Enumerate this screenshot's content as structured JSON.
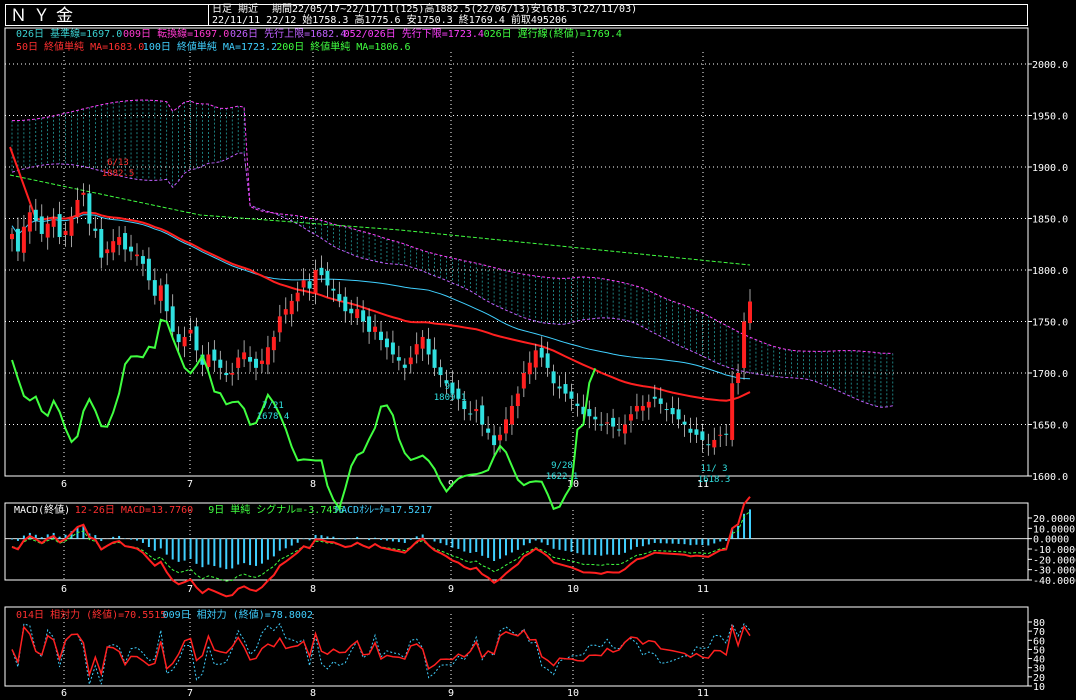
{
  "header": {
    "symbol": "ＮＹ金",
    "mode": "日足  期近",
    "period_info": "期間22/05/17~22/11/11(125)高1882.5(22/06/13)安1618.3(22/11/03)",
    "ohlc_info": "22/11/11 22/12 始1758.3 高1775.6 安1750.3 終1769.4 前取495206"
  },
  "legend_ichimoku": [
    {
      "text": "026日 基準線=1697.0",
      "color": "#3ad0d0"
    },
    {
      "text": "009日 転換線=1697.0",
      "color": "#ff3ad0"
    },
    {
      "text": "026日 先行上限=1682.4",
      "color": "#c060ff"
    },
    {
      "text": "052/026日 先行下限=1723.4",
      "color": "#ff40ff"
    },
    {
      "text": "026日 遅行線(終値)=1769.4",
      "color": "#40ff40"
    }
  ],
  "legend_ma": [
    {
      "text": "50日 終値単純 MA=1683.0",
      "color": "#ff3030"
    },
    {
      "text": "100日 終値単純 MA=1723.2",
      "color": "#40d0ff"
    },
    {
      "text": "200日 終値単純 MA=1806.6",
      "color": "#40ff40"
    }
  ],
  "macd_legend": [
    {
      "text": "MACD(終値)",
      "color": "#ffffff"
    },
    {
      "text": "12-26日 MACD=13.7760",
      "color": "#ff3030"
    },
    {
      "text": "9日 単純 シグナル=-3.7456",
      "color": "#40ff40"
    },
    {
      "text": "MACDｵｼﾚｰﾀ=17.5217",
      "color": "#40d0ff"
    }
  ],
  "rsi_legend": [
    {
      "text": "014日 相対力 (終値)=70.5515",
      "color": "#ff3030"
    },
    {
      "text": "009日 相対力 (終値)=78.8002",
      "color": "#40d0ff"
    }
  ],
  "annotations": {
    "high": "6/13\n1882.5",
    "low_jul": "7/21\n1678.4",
    "low_sep": "9/28\n1622.1",
    "low_nov": "11/ 3\n1618.3",
    "sep_high": "9/\n1809.1"
  },
  "x_months": [
    "6",
    "7",
    "8",
    "9",
    "10",
    "11"
  ],
  "price_ticks": [
    "2000.0",
    "1950.0",
    "1900.0",
    "1850.0",
    "1800.0",
    "1750.0",
    "1700.0",
    "1650.0",
    "1600.0"
  ],
  "macd_ticks": [
    "20.0000",
    "10.0000",
    "0.0000",
    "-10.0000",
    "-20.0000",
    "-30.0000",
    "-40.0000"
  ],
  "rsi_ticks": [
    "80",
    "70",
    "60",
    "50",
    "40",
    "30",
    "20",
    "10"
  ],
  "colors": {
    "up": "#ff2020",
    "down": "#30e0e0",
    "cloud": "#30d0d0",
    "grid": "#ffffff"
  },
  "chart_data": {
    "type": "line",
    "title": "ＮＹ金",
    "closes": [
      1835,
      1818,
      1842,
      1856,
      1848,
      1835,
      1845,
      1850,
      1832,
      1838,
      1852,
      1868,
      1875,
      1845,
      1838,
      1812,
      1820,
      1828,
      1832,
      1820,
      1818,
      1815,
      1806,
      1790,
      1775,
      1785,
      1760,
      1740,
      1730,
      1735,
      1742,
      1722,
      1708,
      1718,
      1712,
      1705,
      1698,
      1700,
      1715,
      1720,
      1711,
      1705,
      1712,
      1725,
      1735,
      1755,
      1762,
      1770,
      1778,
      1790,
      1782,
      1800,
      1795,
      1785,
      1780,
      1770,
      1760,
      1758,
      1762,
      1750,
      1740,
      1745,
      1732,
      1725,
      1718,
      1712,
      1705,
      1715,
      1728,
      1735,
      1718,
      1705,
      1698,
      1690,
      1680,
      1675,
      1665,
      1660,
      1665,
      1650,
      1642,
      1630,
      1640,
      1655,
      1668,
      1680,
      1700,
      1710,
      1722,
      1715,
      1705,
      1690,
      1685,
      1680,
      1675,
      1668,
      1660,
      1658,
      1655,
      1650,
      1652,
      1648,
      1645,
      1650,
      1660,
      1668,
      1668,
      1672,
      1675,
      1670,
      1665,
      1660,
      1655,
      1650,
      1642,
      1640,
      1635,
      1630,
      1635,
      1640,
      1640,
      1690,
      1700,
      1750,
      1769.4
    ],
    "ylim": [
      1600,
      2000
    ]
  }
}
